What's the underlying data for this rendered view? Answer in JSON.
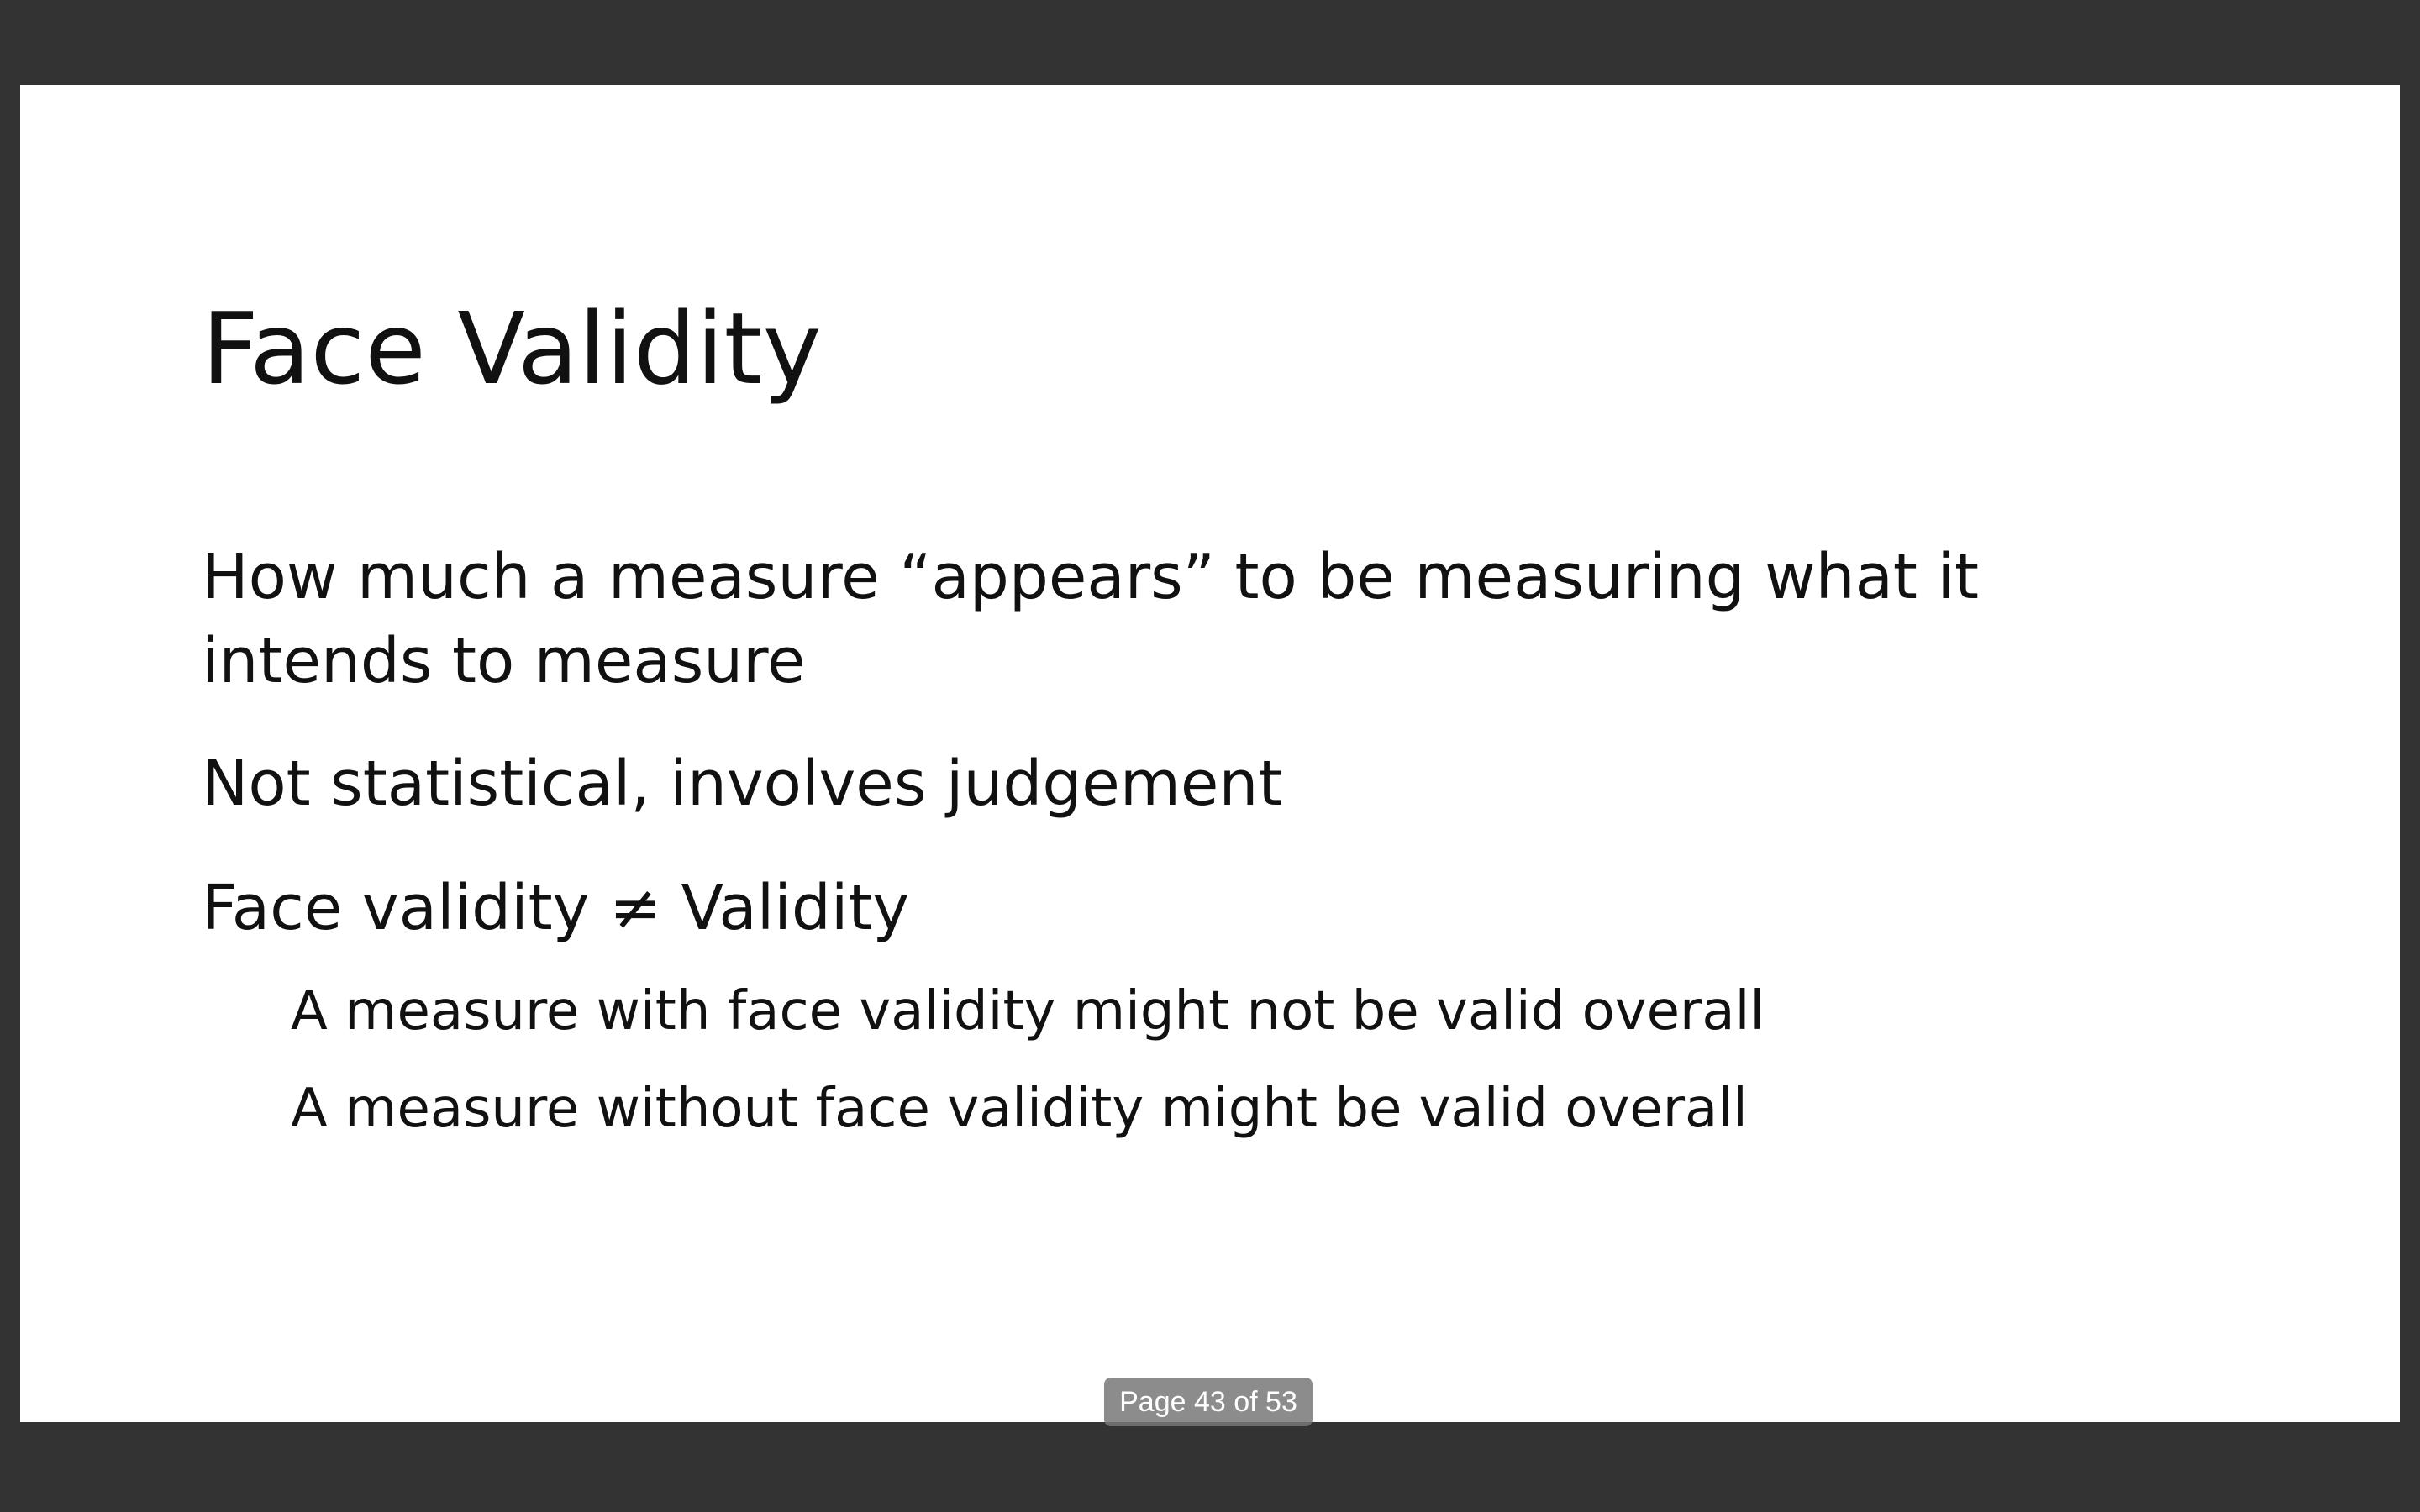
{
  "slide": {
    "title": "Face Validity",
    "bullets": [
      "How much a measure “appears” to be measuring what it",
      "intends to measure",
      "Not statistical, involves judgement",
      "Face validity ≠ Validity"
    ],
    "sub_bullets": [
      "A measure with face validity might not be valid overall",
      "A measure without face validity might be valid overall"
    ]
  },
  "viewer": {
    "page_indicator": "Page 43 of 53"
  }
}
